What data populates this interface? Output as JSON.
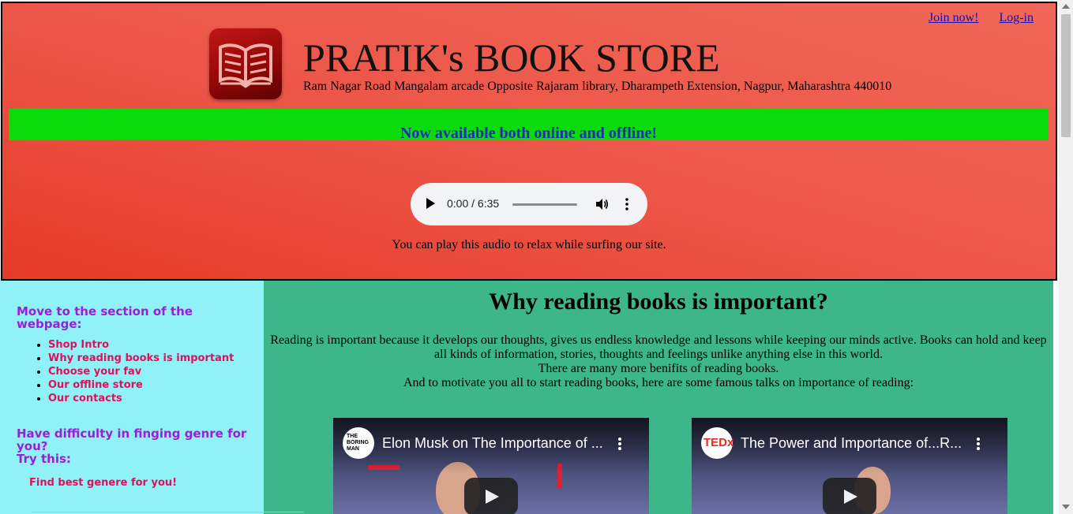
{
  "header": {
    "links": {
      "join": "Join now!",
      "login": "Log-in"
    },
    "logo_icon": "open-book-icon",
    "title": "PRATIK's BOOK STORE",
    "address": "Ram Nagar Road Mangalam arcade Opposite Rajaram library, Dharampeth Extension, Nagpur, Maharashtra 440010",
    "banner": "Now available both online and offline!",
    "banner_color": "#0bdb0b"
  },
  "audio": {
    "time": "0:00 / 6:35",
    "progress": 0,
    "caption": "You can play this audio to relax while surfing our site."
  },
  "sidebar": {
    "nav_heading": "Move to the section of the webpage:",
    "items": [
      "Shop Intro",
      "Why reading books is important",
      "Choose your fav",
      "Our offline store",
      "Our contacts"
    ],
    "genre_heading_line1": "Have difficulty in finging genre for you?",
    "genre_heading_line2": "Try this:",
    "genre_link": "Find best genere for you!"
  },
  "main": {
    "heading": "Why reading books is important?",
    "para_line1": "Reading is important because it develops our thoughts, gives us endless knowledge and lessons while keeping our minds active. Books can hold and keep all kinds of information, stories, thoughts and feelings unlike anything else in this world.",
    "para_line2": "There are many more benifits of reading books.",
    "para_line3": "And to motivate you all to start reading books, here are some famous talks on importance of reading:",
    "videos": [
      {
        "title": "Elon Musk on The Importance of ...",
        "channel": "THE BORING MAN"
      },
      {
        "title": "The Power and Importance of...R...",
        "channel": "TEDx"
      }
    ]
  },
  "colors": {
    "header_red": "#ec5547",
    "sidebar_bg": "#90f1f7",
    "main_bg": "#3db68a",
    "link_pink": "#e0105a",
    "heading_purple": "#9b1ed8"
  }
}
